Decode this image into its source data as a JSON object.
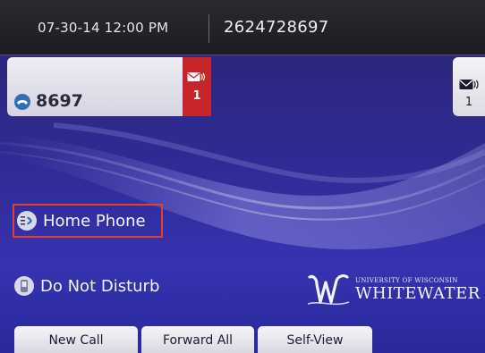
{
  "status_bar": {
    "datetime": "07-30-14 12:00 PM",
    "phone_number": "2624728697"
  },
  "line_key": {
    "icon": "handset-icon",
    "label": "8697",
    "voicemail_count": "1"
  },
  "right_voicemail": {
    "icon": "envelope-icon",
    "count": "1"
  },
  "feature_keys": {
    "home_phone": {
      "icon": "speed-dial-icon",
      "label": "Home Phone"
    },
    "do_not_disturb": {
      "icon": "do-not-disturb-icon",
      "label": "Do Not Disturb"
    }
  },
  "logo": {
    "line1": "UNIVERSITY OF WISCONSIN",
    "line2": "WHITEWATER"
  },
  "softkeys": {
    "new_call": "New Call",
    "forward_all": "Forward All",
    "self_view": "Self-View"
  },
  "colors": {
    "background": "#2f2a93",
    "topbar": "#1c1c22",
    "voicemail_red": "#c8252b",
    "highlight_border": "#e0412b",
    "line_icon_blue": "#2e6fb6"
  }
}
